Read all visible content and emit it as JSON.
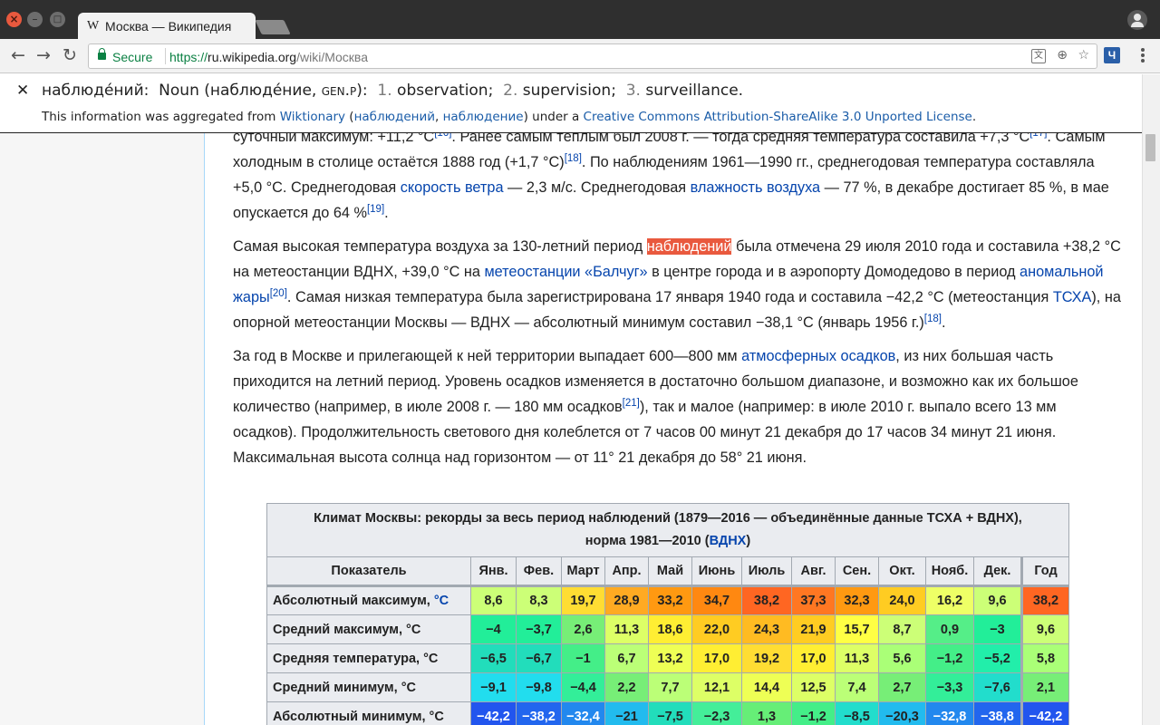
{
  "browser": {
    "tab_title": "Москва — Википедия",
    "favicon": "W",
    "secure_label": "Secure",
    "url_scheme": "https://",
    "url_host": "ru.wikipedia.org",
    "url_path": "/wiki/Москва",
    "extension_label": "Ч"
  },
  "popup": {
    "word": "наблюде́ний:",
    "pos": "Noun",
    "lemma": "наблюде́ние",
    "gram": "gen.p",
    "senses": [
      "observation;",
      "supervision;",
      "surveillance."
    ],
    "sense_nums": [
      "1.",
      "2.",
      "3."
    ],
    "attr_prefix": "This information was aggregated from",
    "attr_source": "Wiktionary",
    "attr_link1": "наблюдений",
    "attr_link2": "наблюдение",
    "attr_mid": "under a",
    "attr_license": "Creative Commons Attribution-ShareAlike 3.0 Unported License"
  },
  "article": {
    "p1": [
      {
        "t": "суточный максимум: +11,2 °C"
      },
      {
        "sup": "[16]"
      },
      {
        "t": ". Ранее самым тёплым был 2008 г. — тогда средняя температура составила +7,3 °C"
      },
      {
        "sup": "[17]"
      },
      {
        "t": ". Самым холодным в столице остаётся 1888 год (+1,7 °C)"
      },
      {
        "sup": "[18]"
      },
      {
        "t": ". По наблюдениям 1961—1990 гг., среднегодовая температура составляла +5,0 °C. Среднегодовая "
      },
      {
        "a": "скорость ветра"
      },
      {
        "t": " — 2,3 м/с. Среднегодовая "
      },
      {
        "a": "влажность воздуха"
      },
      {
        "t": " — 77 %, в декабре достигает 85 %, в мае опускается до 64 %"
      },
      {
        "sup": "[19]"
      },
      {
        "t": "."
      }
    ],
    "p2": [
      {
        "t": "Самая высокая температура воздуха за 130-летний период "
      },
      {
        "hl": "наблюдений"
      },
      {
        "t": " была отмечена 29 июля 2010 года и составила +38,2 °C на метеостанции ВДНХ, +39,0 °C на "
      },
      {
        "a": "метеостанции «Балчуг»"
      },
      {
        "t": " в центре города и в аэропорту Домодедово в период "
      },
      {
        "a": "аномальной жары"
      },
      {
        "sup": "[20]"
      },
      {
        "t": ". Самая низкая температура была зарегистрирована 17 января 1940 года и составила −42,2 °C (метеостанция "
      },
      {
        "a": "ТСХА"
      },
      {
        "t": "), на опорной метеостанции Москвы — ВДНХ — абсолютный минимум составил −38,1 °C (январь 1956 г.)"
      },
      {
        "sup": "[18]"
      },
      {
        "t": "."
      }
    ],
    "p3": [
      {
        "t": "За год в Москве и прилегающей к ней территории выпадает 600—800 мм "
      },
      {
        "a": "атмосферных осадков"
      },
      {
        "t": ", из них большая часть приходится на летний период. Уровень осадков изменяется в достаточно большом диапазоне, и возможно как их большое количество (например, в июле 2008 г. — 180 мм осадков"
      },
      {
        "sup": "[21]"
      },
      {
        "t": "), так и малое (например: в июле 2010 г. выпало всего 13 мм осадков). Продолжительность светового дня колеблется от 7 часов 00 минут 21 декабря до 17 часов 34 минут 21 июня. Максимальная высота солнца над горизонтом — от 11° 21 декабря до 58° 21 июня."
      }
    ]
  },
  "climate": {
    "caption_line1": "Климат Москвы: рекорды за весь период наблюдений (1879—2016 — объединённые данные ТСХА + ВДНХ),",
    "caption_line2_prefix": "норма 1981—2010 (",
    "caption_link": "ВДНХ",
    "caption_line2_suffix": ")",
    "header": [
      "Показатель",
      "Янв.",
      "Фев.",
      "Март",
      "Апр.",
      "Май",
      "Июнь",
      "Июль",
      "Авг.",
      "Сен.",
      "Окт.",
      "Нояб.",
      "Дек.",
      "Год"
    ],
    "rows": [
      {
        "label": "Абсолютный максимум, ",
        "unit_link": "°C",
        "values": [
          "8,6",
          "8,3",
          "19,7",
          "28,9",
          "33,2",
          "34,7",
          "38,2",
          "37,3",
          "32,3",
          "24,0",
          "16,2",
          "9,6",
          "38,2"
        ],
        "colors": [
          "#ccff77",
          "#ccff77",
          "#ffdd33",
          "#ffaa22",
          "#ff9911",
          "#ff8811",
          "#ff6622",
          "#ff7722",
          "#ff9911",
          "#ffcc22",
          "#eeff66",
          "#ccff77",
          "#ff6622"
        ]
      },
      {
        "label": "Средний максимум, °C",
        "values": [
          "−4",
          "−3,7",
          "2,6",
          "11,3",
          "18,6",
          "22,0",
          "24,3",
          "21,9",
          "15,7",
          "8,7",
          "0,9",
          "−3",
          "9,6"
        ],
        "colors": [
          "#22ee99",
          "#22ee99",
          "#77ee77",
          "#ddff66",
          "#ffee33",
          "#ffcc22",
          "#ffbb22",
          "#ffcc22",
          "#ffff44",
          "#ccff77",
          "#55ee88",
          "#22ee99",
          "#ccff77"
        ]
      },
      {
        "label": "Средняя температура, °C",
        "values": [
          "−6,5",
          "−6,7",
          "−1",
          "6,7",
          "13,2",
          "17,0",
          "19,2",
          "17,0",
          "11,3",
          "5,6",
          "−1,2",
          "−5,2",
          "5,8"
        ],
        "colors": [
          "#22ddbb",
          "#22ddbb",
          "#44ee88",
          "#bbff77",
          "#eeff55",
          "#ffee33",
          "#ffdd33",
          "#ffee33",
          "#ddff66",
          "#aaff77",
          "#44ee88",
          "#22eeaa",
          "#aaff77"
        ]
      },
      {
        "label": "Средний минимум, °C",
        "values": [
          "−9,1",
          "−9,8",
          "−4,4",
          "2,2",
          "7,7",
          "12,1",
          "14,4",
          "12,5",
          "7,4",
          "2,7",
          "−3,3",
          "−7,6",
          "2,1"
        ],
        "colors": [
          "#22ddee",
          "#22ddee",
          "#33ee99",
          "#77ee77",
          "#bbff77",
          "#ddff66",
          "#eeff55",
          "#ddff66",
          "#bbff77",
          "#77ee77",
          "#33ee99",
          "#22ddcc",
          "#77ee77"
        ]
      },
      {
        "label": "Абсолютный минимум, °C",
        "values": [
          "−42,2",
          "−38,2",
          "−32,4",
          "−21",
          "−7,5",
          "−2,3",
          "1,3",
          "−1,2",
          "−8,5",
          "−20,3",
          "−32,8",
          "−38,8",
          "−42,2"
        ],
        "colors": [
          "#2255ee",
          "#2266ee",
          "#2288ee",
          "#22bbee",
          "#22ddbb",
          "#44ee99",
          "#66ee77",
          "#44ee88",
          "#22ddcc",
          "#22bbee",
          "#2288ee",
          "#2266ee",
          "#2255ee"
        ]
      }
    ]
  }
}
